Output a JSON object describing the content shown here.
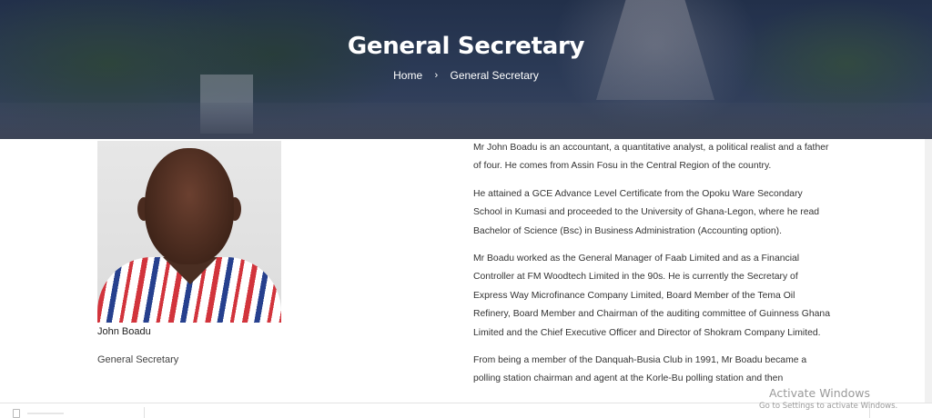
{
  "header": {
    "title": "General Secretary",
    "breadcrumb": {
      "home": "Home",
      "separator": "›",
      "current": "General Secretary"
    }
  },
  "profile": {
    "name": "John Boadu",
    "role": "General Secretary"
  },
  "bio": {
    "paragraphs": [
      "Mr John Boadu is an accountant, a quantitative analyst, a political realist and a father of four. He comes from Assin Fosu in the Central Region of the country.",
      "He attained a GCE Advance Level Certificate from the Opoku Ware Secondary School in Kumasi and proceeded to the University of Ghana-Legon, where he read Bachelor of Science (Bsc) in Business Administration (Accounting option).",
      "Mr Boadu worked as the General Manager of Faab Limited and as a Financial Controller at FM Woodtech Limited in the 90s. He is currently the Secretary of Express Way Microfinance Company Limited, Board Member of the Tema Oil Refinery, Board Member and Chairman of the auditing committee of Guinness Ghana Limited and the Chief Executive Officer and Director of Shokram Company Limited.",
      "From being a member of the Danquah-Busia Club in 1991, Mr Boadu became a polling station chairman and agent at the Korle-Bu polling station and then"
    ]
  },
  "watermark": {
    "line1": "Activate Windows",
    "line2": "Go to Settings to activate Windows."
  },
  "colors": {
    "hero_overlay": "#2c3b57",
    "text": "#333333",
    "kente_red": "#d2343c",
    "kente_blue": "#26408e"
  }
}
